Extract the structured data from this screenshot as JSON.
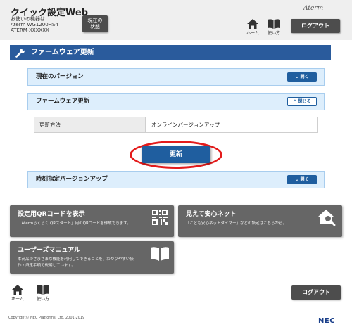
{
  "header": {
    "app_title": "クイック設定Web",
    "device_label": "お使いの機器は",
    "device_model": "Aterm WG1200HS4",
    "device_id": "ATERM-XXXXXX",
    "status_button": "現在の\n状態",
    "brand": "Aterm",
    "home_label": "ホーム",
    "help_label": "使い方",
    "logout_label": "ログアウト"
  },
  "page": {
    "title": "ファームウェア更新"
  },
  "sections": {
    "current_version": {
      "label": "現在のバージョン",
      "toggle": "開く"
    },
    "firmware_update": {
      "label": "ファームウェア更新",
      "toggle": "閉じる"
    },
    "scheduled_update": {
      "label": "時刻指定バージョンアップ",
      "toggle": "開く"
    }
  },
  "update_method": {
    "label": "更新方法",
    "value": "オンラインバージョンアップ"
  },
  "update_button": "更新",
  "tiles": {
    "qr": {
      "title": "設定用QRコードを表示",
      "desc": "「Atermらくらく QRスタート」用のQRコードを作成できます。",
      "icon": "qr-code-icon"
    },
    "safety": {
      "title": "見えて安心ネット",
      "desc": "「こども安心ネットタイマー」などの設定はこちらから。",
      "icon": "house-search-icon"
    },
    "manual": {
      "title": "ユーザーズマニュアル",
      "desc_line1": "本商品のさまざまな機能を利用してできることを、わかりやすい操",
      "desc_line2": "作・設定手順で説明しています。",
      "icon": "book-icon"
    }
  },
  "footer": {
    "home_label": "ホーム",
    "help_label": "使い方",
    "logout_label": "ログアウト",
    "copyright": "Copyright© NEC Platforms, Ltd. 2001-2019",
    "company_logo": "NEC"
  },
  "colors": {
    "primary_blue": "#2a5b9c",
    "button_blue": "#1f5e9f",
    "section_bg": "#ddeefc",
    "tile_gray": "#666666",
    "highlight_red": "#e41b1b"
  }
}
